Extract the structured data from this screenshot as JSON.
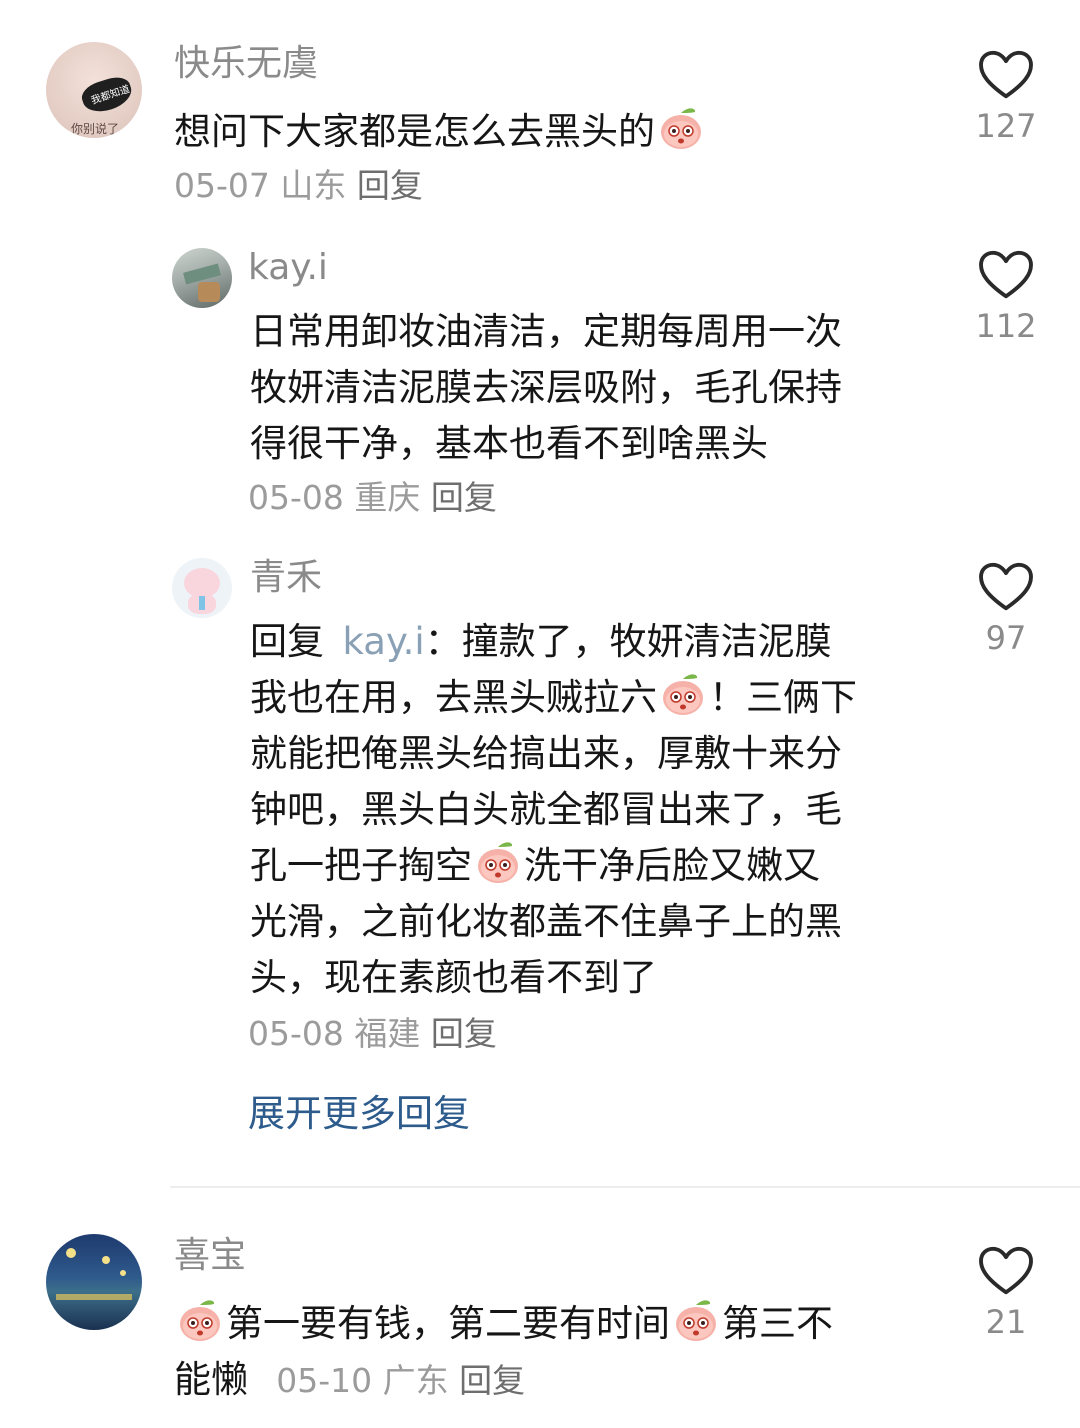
{
  "comments": [
    {
      "user": "快乐无虞",
      "avatar_text": "我都知道",
      "avatar_sub": "你别说了",
      "text_parts": [
        "想问下大家都是怎么去黑头的"
      ],
      "date": "05-07",
      "location": "山东",
      "reply_label": "回复",
      "likes": "127",
      "replies": [
        {
          "user": "kay.i",
          "lines": [
            "日常用卸妆油清洁，定期每周用一次",
            "牧妍清洁泥膜去深层吸附，毛孔保持",
            "得很干净，基本也看不到啥黑头"
          ],
          "date": "05-08",
          "location": "重庆",
          "reply_label": "回复",
          "likes": "112"
        },
        {
          "user": "青禾",
          "reply_prefix": "回复",
          "mention": "kay.i",
          "lines": [
            "：撞款了，牧妍清洁泥膜",
            "我也在用，去黑头贼拉六",
            "！三俩下",
            "就能把俺黑头给搞出来，厚敷十来分",
            "钟吧，黑头白头就全都冒出来了，毛",
            "孔一把子掏空",
            "洗干净后脸又嫩又",
            "光滑，之前化妆都盖不住鼻子上的黑",
            "头，现在素颜也看不到了"
          ],
          "date": "05-08",
          "location": "福建",
          "reply_label": "回复",
          "likes": "97"
        }
      ],
      "expand_label": "展开更多回复"
    },
    {
      "user": "喜宝",
      "text_parts": [
        "第一要有钱，第二要有时间",
        "第三不",
        "能懒"
      ],
      "date": "05-10",
      "location": "广东",
      "reply_label": "回复",
      "likes": "21"
    }
  ],
  "icons": {
    "like": "heart-outline-icon",
    "emoji": "peach-emoji-icon"
  },
  "colors": {
    "link": "#2d5b8c",
    "muted": "#9b9b9b",
    "text": "#161616",
    "mention": "#8aa0b4"
  }
}
